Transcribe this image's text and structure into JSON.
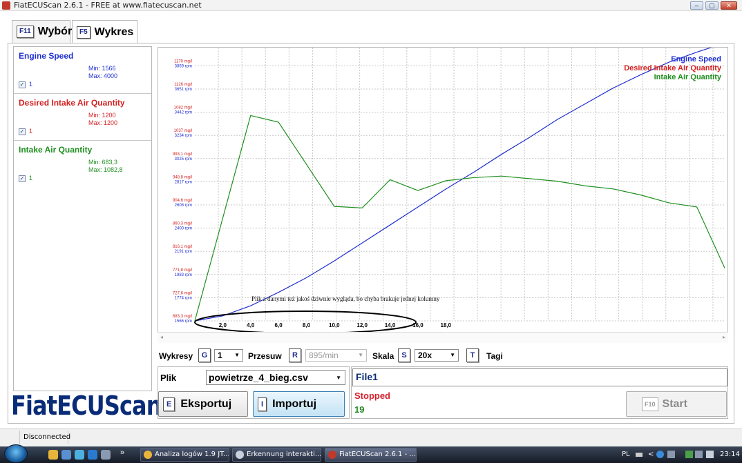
{
  "window": {
    "title": "FiatECUScan 2.6.1 - FREE at www.fiatecuscan.net",
    "min_glyph": "–",
    "max_glyph": "▢",
    "close_glyph": "✕"
  },
  "tabs": [
    {
      "key": "F11",
      "label": "Wybór"
    },
    {
      "key": "F5",
      "label": "Wykres"
    }
  ],
  "series": [
    {
      "name": "Engine Speed",
      "color": "#1f2fd0",
      "min": "Min: 1566",
      "max": "Max: 4000",
      "check": "1"
    },
    {
      "name": "Desired Intake Air Quantity",
      "color": "#d42020",
      "min": "Min: 1200",
      "max": "Max: 1200",
      "check": "1"
    },
    {
      "name": "Intake Air Quantity",
      "color": "#1f8f1f",
      "min": "Min: 683,3",
      "max": "Max: 1082,8",
      "check": "1"
    }
  ],
  "logo": "FiatECUScan",
  "chart_data": {
    "type": "line",
    "title": "",
    "legend": [
      "Engine Speed",
      "Desired Intake Air Quantity",
      "Intake Air Quantity"
    ],
    "legend_position": "top-right",
    "grid": true,
    "x_ticks": [
      "2,0",
      "4,0",
      "6,0",
      "8,0",
      "10,0",
      "12,0",
      "14,0",
      "16,0",
      "18,0"
    ],
    "xlim": [
      0,
      38
    ],
    "y_ticks": [
      {
        "mg": "683,3 mg/l",
        "rpm": "1566 rpm"
      },
      {
        "mg": "727,6 mg/l",
        "rpm": "1774 rpm"
      },
      {
        "mg": "771,8 mg/l",
        "rpm": "1983 rpm"
      },
      {
        "mg": "816,1 mg/l",
        "rpm": "2191 rpm"
      },
      {
        "mg": "860,3 mg/l",
        "rpm": "2400 rpm"
      },
      {
        "mg": "904,6 mg/l",
        "rpm": "2608 rpm"
      },
      {
        "mg": "948,8 mg/l",
        "rpm": "2817 rpm"
      },
      {
        "mg": "993,1 mg/l",
        "rpm": "3025 rpm"
      },
      {
        "mg": "1037 mg/l",
        "rpm": "3234 rpm"
      },
      {
        "mg": "1082 mg/l",
        "rpm": "3442 rpm"
      },
      {
        "mg": "1126 mg/l",
        "rpm": "3651 rpm"
      },
      {
        "mg": "1170 mg/l",
        "rpm": "3859 rpm"
      }
    ],
    "ylim_rpm": [
      1566,
      4000
    ],
    "ylim_mg": [
      683.3,
      1215
    ],
    "series": [
      {
        "name": "Engine Speed",
        "color": "#1f2fd0",
        "unit": "rpm",
        "x": [
          0,
          1,
          2,
          3,
          4,
          5,
          6,
          7,
          8,
          9,
          10,
          11,
          12,
          13,
          14,
          15,
          16,
          17,
          18,
          19
        ],
        "y": [
          1566,
          1610,
          1700,
          1820,
          1950,
          2100,
          2260,
          2420,
          2580,
          2740,
          2890,
          3050,
          3200,
          3360,
          3500,
          3640,
          3760,
          3870,
          3960,
          4040
        ]
      },
      {
        "name": "Intake Air Quantity",
        "color": "#1f8f1f",
        "unit": "mg/l",
        "x": [
          0,
          2,
          3,
          5,
          6,
          7,
          8,
          9,
          10,
          11,
          13,
          14,
          15,
          16,
          17,
          18,
          19
        ],
        "y": [
          683.3,
          1082.8,
          1070,
          906,
          903,
          958,
          937,
          956,
          962,
          965,
          955,
          946,
          940,
          928,
          913,
          905,
          786
        ]
      }
    ]
  },
  "chart_annotation": "Plik z danymi też jakoś dziwnie wygląda, bo chyba brakuje jednej kolumny",
  "controls": {
    "wykresy_label": "Wykresy",
    "wykresy_key": "G",
    "wykresy_value": "1",
    "przesuw_label": "Przesuw",
    "przesuw_key": "R",
    "przesuw_value": "895/min",
    "skala_label": "Skala",
    "skala_key": "S",
    "skala_value": "20x",
    "tagi_key": "T",
    "tagi_label": "Tagi"
  },
  "file": {
    "label": "Plik",
    "value": "powietrze_4_bieg.csv",
    "export_key": "E",
    "export_label": "Eksportuj",
    "import_key": "I",
    "import_label": "Importuj"
  },
  "status": {
    "file_name": "File1",
    "state": "Stopped",
    "count": "19",
    "start_key": "F10",
    "start_label": "Start"
  },
  "statusbar": {
    "connection": "Disconnected"
  },
  "taskbar": {
    "items": [
      {
        "label": "Analiza logów 1.9 JT...",
        "icon": "chrome-icon"
      },
      {
        "label": "Erkennung interakti...",
        "icon": "app-icon"
      },
      {
        "label": "FiatECUScan 2.6.1 - ...",
        "icon": "fiatecuscan-icon"
      }
    ],
    "overflow": "»",
    "lang": "PL",
    "tray_arrow": "<",
    "clock": "23:14"
  }
}
